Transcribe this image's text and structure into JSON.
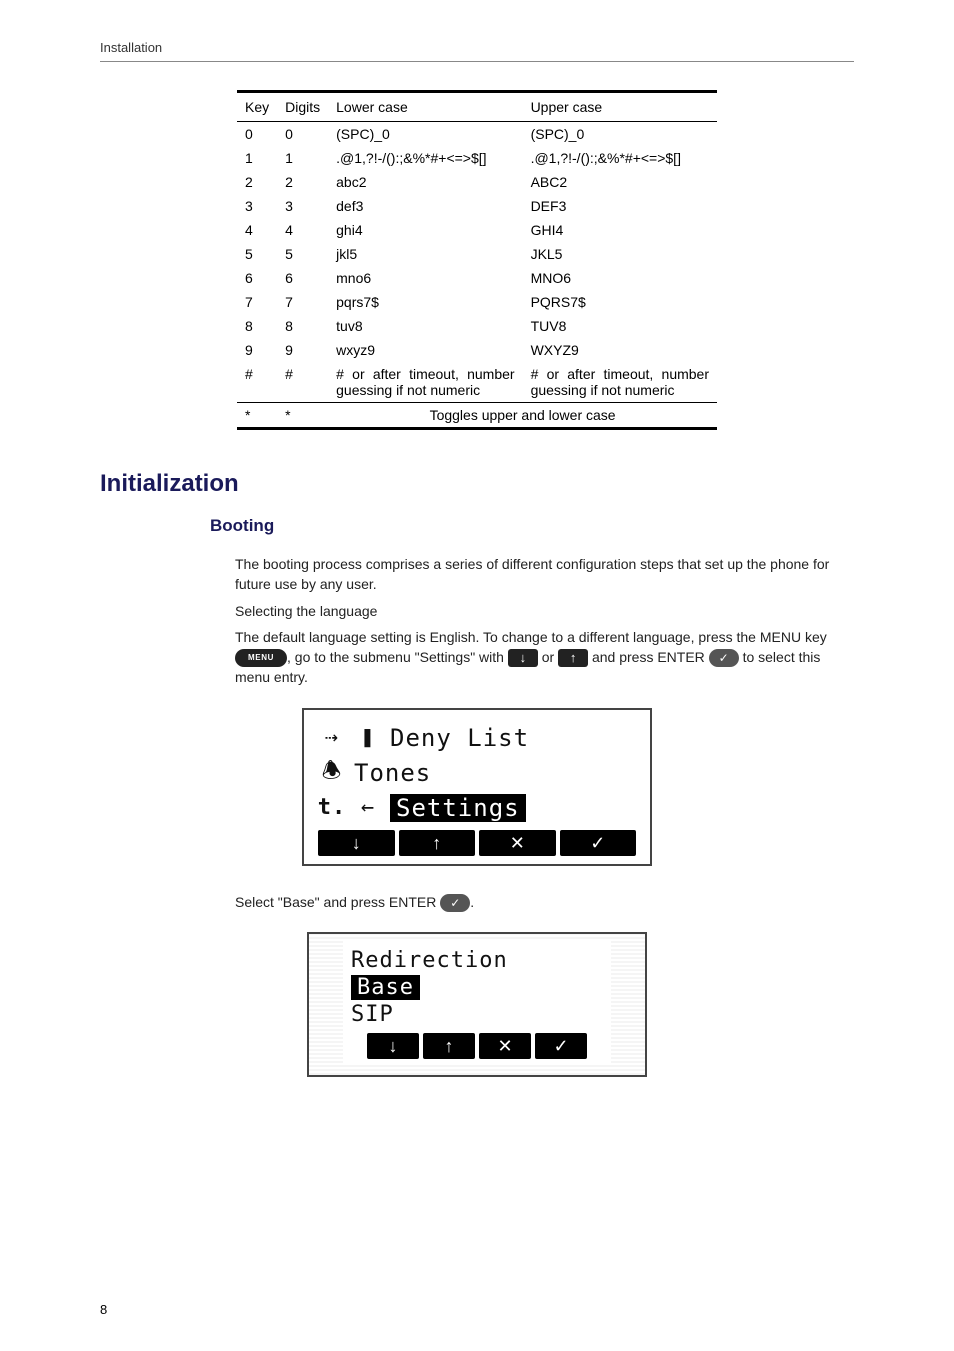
{
  "page": {
    "running_head": "Installation",
    "page_number": "8"
  },
  "table": {
    "headers": {
      "key": "Key",
      "digits": "Digits",
      "lower": "Lower case",
      "upper": "Upper case"
    },
    "rows": [
      {
        "key": "0",
        "digits": "0",
        "lower": "(SPC)_0",
        "upper": "(SPC)_0"
      },
      {
        "key": "1",
        "digits": "1",
        "lower": ".@1,?!-/():;&%*#+<=>$[]",
        "upper": ".@1,?!-/():;&%*#+<=>$[]"
      },
      {
        "key": "2",
        "digits": "2",
        "lower": "abc2",
        "upper": "ABC2"
      },
      {
        "key": "3",
        "digits": "3",
        "lower": "def3",
        "upper": "DEF3"
      },
      {
        "key": "4",
        "digits": "4",
        "lower": "ghi4",
        "upper": "GHI4"
      },
      {
        "key": "5",
        "digits": "5",
        "lower": "jkl5",
        "upper": "JKL5"
      },
      {
        "key": "6",
        "digits": "6",
        "lower": "mno6",
        "upper": "MNO6"
      },
      {
        "key": "7",
        "digits": "7",
        "lower": "pqrs7$",
        "upper": "PQRS7$"
      },
      {
        "key": "8",
        "digits": "8",
        "lower": "tuv8",
        "upper": "TUV8"
      },
      {
        "key": "9",
        "digits": "9",
        "lower": "wxyz9",
        "upper": "WXYZ9"
      },
      {
        "key": "#",
        "digits": "#",
        "lower": "# or after timeout, number guessing if not numeric",
        "upper": "# or after timeout, number guessing if not numeric"
      }
    ],
    "footer": {
      "key": "*",
      "digits": "*",
      "span": "Toggles upper and lower case"
    }
  },
  "section": {
    "title": "Initialization",
    "subsection": "Booting",
    "p1": "The booting process comprises a series of different configuration steps that set up the phone for future use by any user.",
    "p2": "Selecting the language",
    "p3a": "The default language setting is English. To change to a different language, press the MENU key ",
    "menu_label": "MENU",
    "p3b": ", go to the submenu \"Settings\" with ",
    "p3c": " or ",
    "p3d": " and press ENTER ",
    "p3e": " to select this menu entry.",
    "p4a": "Select \"Base\" and press ENTER ",
    "p4b": "."
  },
  "icons": {
    "down": "↓",
    "up": "↑",
    "check": "✓",
    "cross": "✕"
  },
  "lcd1": {
    "line1": "Deny List",
    "line2": "Tones",
    "line3": "Settings"
  },
  "lcd2": {
    "line1": "Redirection",
    "line2": "Base",
    "line3": "SIP"
  }
}
